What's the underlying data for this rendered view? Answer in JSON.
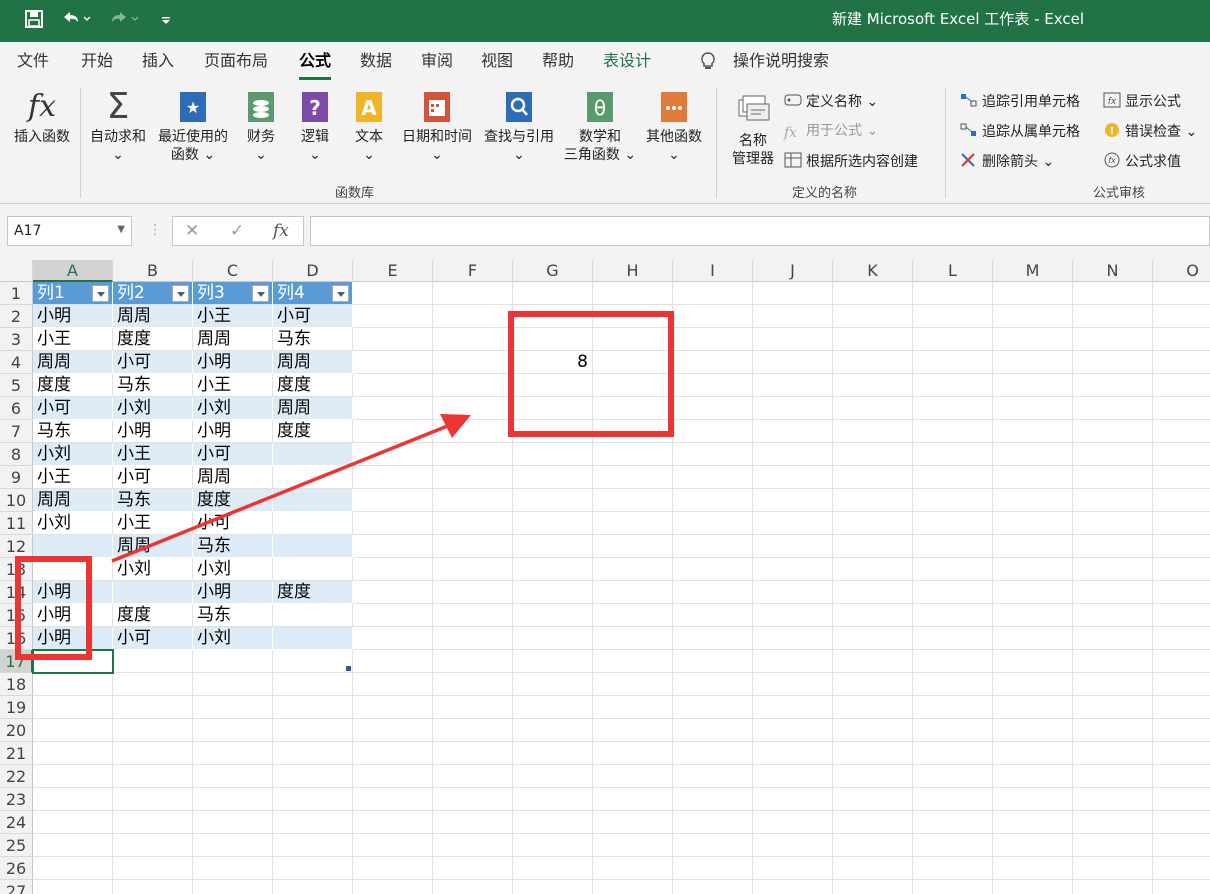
{
  "window": {
    "title": "新建 Microsoft Excel 工作表  -  Excel"
  },
  "quick_access": {
    "save_icon": "save-icon",
    "undo_icon": "undo-icon",
    "redo_icon": "redo-icon",
    "customize_icon": "customize-qat-icon"
  },
  "menu": {
    "tabs": [
      "文件",
      "开始",
      "插入",
      "页面布局",
      "公式",
      "数据",
      "审阅",
      "视图",
      "帮助",
      "表设计"
    ],
    "active": "公式",
    "search": "操作说明搜索"
  },
  "ribbon": {
    "insert_function": "插入函数",
    "function_library": {
      "label": "函数库",
      "buttons": [
        {
          "line1": "自动求和",
          "line2": "⌄"
        },
        {
          "line1": "最近使用的",
          "line2": "函数 ⌄"
        },
        {
          "line1": "财务",
          "line2": "⌄"
        },
        {
          "line1": "逻辑",
          "line2": "⌄"
        },
        {
          "line1": "文本",
          "line2": "⌄"
        },
        {
          "line1": "日期和时间",
          "line2": "⌄"
        },
        {
          "line1": "查找与引用",
          "line2": "⌄"
        },
        {
          "line1": "数学和",
          "line2": "三角函数 ⌄"
        },
        {
          "line1": "其他函数",
          "line2": "⌄"
        }
      ]
    },
    "defined_names": {
      "label": "定义的名称",
      "name_manager_line1": "名称",
      "name_manager_line2": "管理器",
      "define_name": "定义名称  ⌄",
      "use_in_formula": "用于公式 ⌄",
      "create_from_selection": "根据所选内容创建"
    },
    "formula_auditing": {
      "label": "公式审核",
      "trace_precedents": "追踪引用单元格",
      "trace_dependents": "追踪从属单元格",
      "remove_arrows": "删除箭头  ⌄",
      "show_formulas": "显示公式",
      "error_checking": "错误检查  ⌄",
      "evaluate_formula": "公式求值"
    }
  },
  "formula_bar": {
    "name_box": "A17",
    "cancel": "✕",
    "enter": "✓",
    "fx": "fx",
    "content": ""
  },
  "sheet": {
    "columns": [
      "A",
      "B",
      "C",
      "D",
      "E",
      "F",
      "G",
      "H",
      "I",
      "J",
      "K",
      "L",
      "M",
      "N",
      "O"
    ],
    "rows": [
      "1",
      "2",
      "3",
      "4",
      "5",
      "6",
      "7",
      "8",
      "9",
      "10",
      "11",
      "12",
      "13",
      "14",
      "15",
      "16",
      "17",
      "18",
      "19",
      "20",
      "21",
      "22",
      "23",
      "24",
      "25",
      "26",
      "27"
    ],
    "table_headers": [
      "列1",
      "列2",
      "列3",
      "列4"
    ],
    "table_rows": [
      [
        "小明",
        "周周",
        "小王",
        "小可"
      ],
      [
        "小王",
        "度度",
        "周周",
        "马东"
      ],
      [
        "周周",
        "小可",
        "小明",
        "周周"
      ],
      [
        "度度",
        "马东",
        "小王",
        "度度"
      ],
      [
        "小可",
        "小刘",
        "小刘",
        "周周"
      ],
      [
        "马东",
        "小明",
        "小明",
        "度度"
      ],
      [
        "小刘",
        "小王",
        "小可",
        ""
      ],
      [
        "小王",
        "小可",
        "周周",
        ""
      ],
      [
        "周周",
        "马东",
        "度度",
        ""
      ],
      [
        "小刘",
        "小王",
        "小可",
        ""
      ],
      [
        "",
        "周周",
        "马东",
        ""
      ],
      [
        "",
        "小刘",
        "小刘",
        ""
      ],
      [
        "小明",
        "",
        "小明",
        "度度"
      ],
      [
        "小明",
        "度度",
        "马东",
        ""
      ],
      [
        "小明",
        "小可",
        "小刘",
        ""
      ]
    ],
    "result_value": "8",
    "selected_cell": "A17"
  },
  "colors": {
    "excel_green": "#217346",
    "table_header": "#5b9bd5",
    "table_band": "#ddebf7",
    "annotation_red": "#ee3333"
  }
}
